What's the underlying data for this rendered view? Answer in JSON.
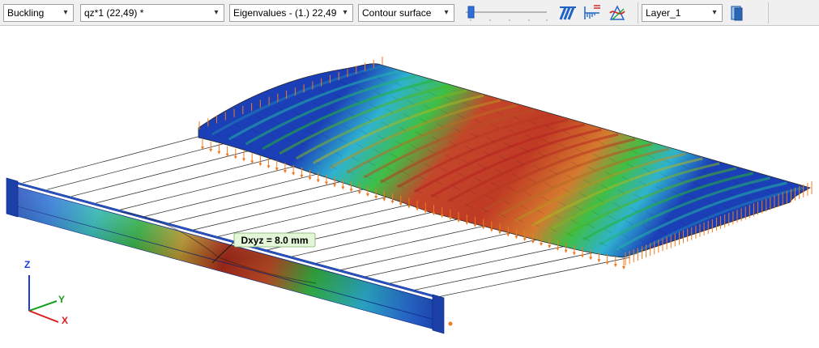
{
  "toolbar": {
    "analysis_type": "Buckling",
    "load_case": "qz*1 (22,49) *",
    "result_type": "Eigenvalues - (1.)  22,49 *",
    "display_mode": "Contour surface",
    "layer": "Layer_1"
  },
  "view": {
    "result_label": "Dxyz = 8.0 mm",
    "axis_z": "Z",
    "axis_y": "Y",
    "axis_x": "X",
    "colors": {
      "axis_z": "#1c3cd8",
      "axis_y": "#16a021",
      "axis_x": "#d81c1c",
      "support_arrows": "#f07a20",
      "contour_min": "#1b3fb7",
      "contour_max": "#c0311f"
    }
  }
}
